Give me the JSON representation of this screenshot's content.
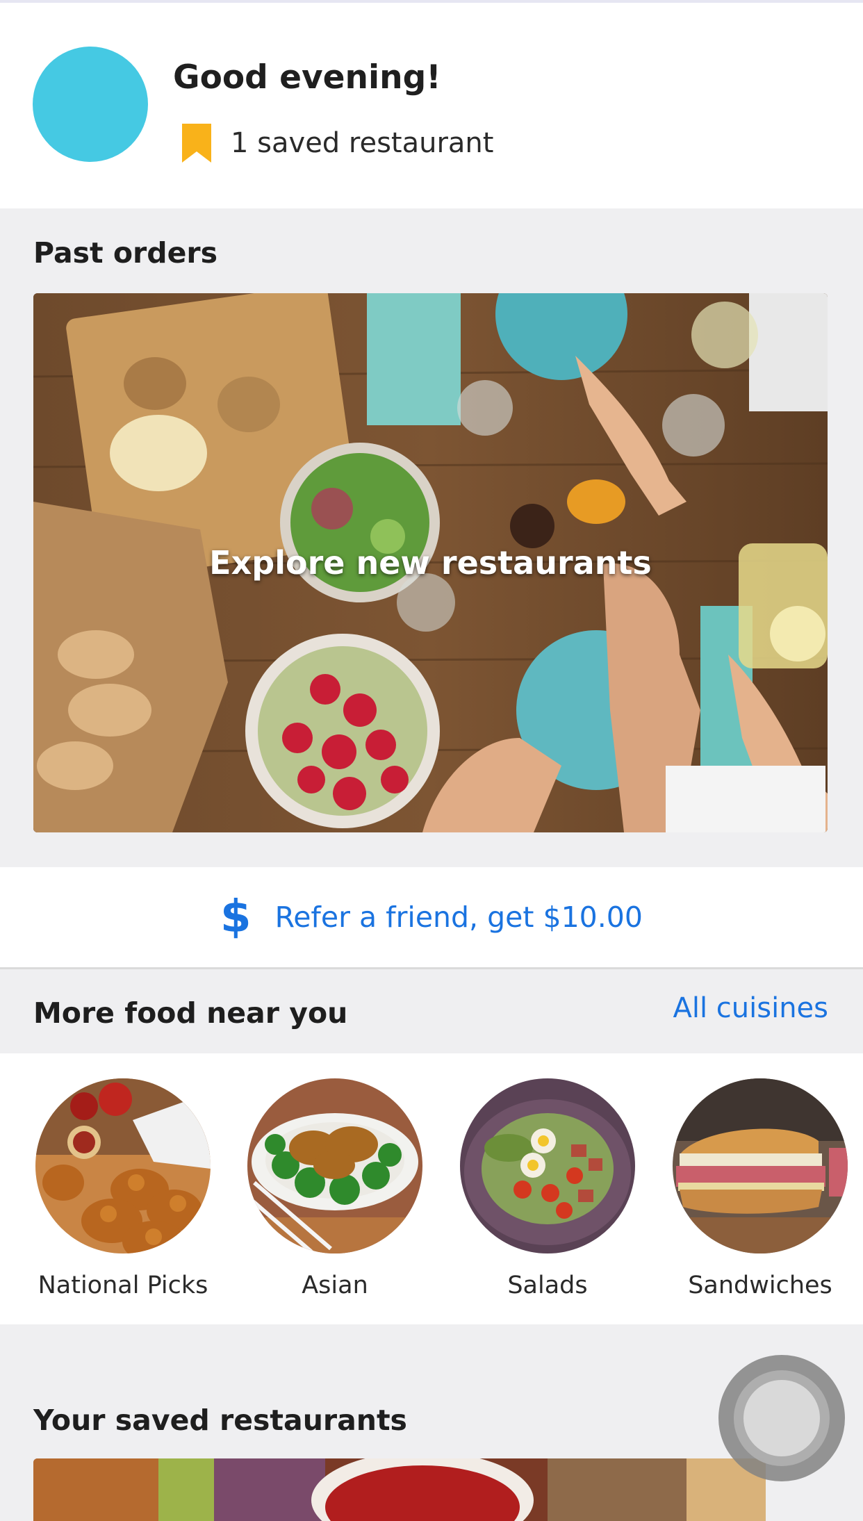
{
  "header": {
    "greeting": "Good evening!",
    "saved_count_text": "1 saved restaurant",
    "bookmark_color": "#f9b21a",
    "avatar_color": "#45c9e3"
  },
  "past_orders": {
    "title": "Past orders",
    "hero_text": "Explore new restaurants"
  },
  "referral": {
    "icon": "dollar-icon",
    "text": "Refer a friend, get $10.00",
    "color": "#1a73e0"
  },
  "more_food": {
    "title": "More food near you",
    "all_link": "All cuisines",
    "cuisines": [
      {
        "label": "National Picks"
      },
      {
        "label": "Asian"
      },
      {
        "label": "Salads"
      },
      {
        "label": "Sandwiches"
      }
    ]
  },
  "saved_restaurants": {
    "title": "Your saved restaurants"
  }
}
